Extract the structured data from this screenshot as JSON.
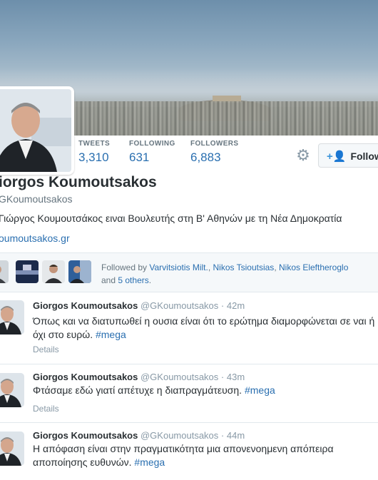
{
  "profile": {
    "name": "iorgos Koumoutsakos",
    "handle": "GKoumoutsakos",
    "bio": "Γιώργος Κουμουτσάκος ειναι Βουλευτής στη Β' Αθηνών με τη Νέα Δημοκρατία",
    "url": "oumoutsakos.gr"
  },
  "stats": [
    {
      "label": "TWEETS",
      "value": "3,310"
    },
    {
      "label": "FOLLOWING",
      "value": "631"
    },
    {
      "label": "FOLLOWERS",
      "value": "6,883"
    }
  ],
  "actions": {
    "settings_icon": "gear-icon",
    "follow_label": "Follow",
    "follow_icon": "add-user-icon"
  },
  "followed_by": {
    "prefix": "Followed by",
    "names": [
      "Varvitsiotis Milt.",
      "Nikos Tsioutsias",
      "Nikos Eleftheroglo"
    ],
    "sep1": ", ",
    "sep2": ", ",
    "and_text": "and",
    "others_link": "5 others",
    "period": "."
  },
  "tweets": [
    {
      "name": "Giorgos Koumoutsakos",
      "handle": "@GKoumoutsakos",
      "dot": "·",
      "time": "42m",
      "text_line1": "Όπως και να διατυπωθεί η ουσια είναι ότι το ερώτημα διαμορφώνεται σε ναι ή",
      "text_line2_prefix": "όχι στο ευρώ. ",
      "hashtag": "#mega",
      "details": "Details"
    },
    {
      "name": "Giorgos Koumoutsakos",
      "handle": "@GKoumoutsakos",
      "dot": "·",
      "time": "43m",
      "text_prefix": "Φτάσαμε εδώ γιατί απέτυχε η διαπραγμάτευση. ",
      "hashtag": "#mega",
      "details": "Details"
    },
    {
      "name": "Giorgos Koumoutsakos",
      "handle": "@GKoumoutsakos",
      "dot": "·",
      "time": "44m",
      "text_line1": "Η απόφαση είναι στην πραγματικότητα μια απονενοημενη απόπειρα",
      "text_line2_prefix": "αποποίησης ευθυνών. ",
      "hashtag": "#mega"
    }
  ],
  "colors": {
    "link": "#2a6fb0",
    "muted": "#66757f",
    "text": "#292f33",
    "border": "#e1e8ed"
  }
}
